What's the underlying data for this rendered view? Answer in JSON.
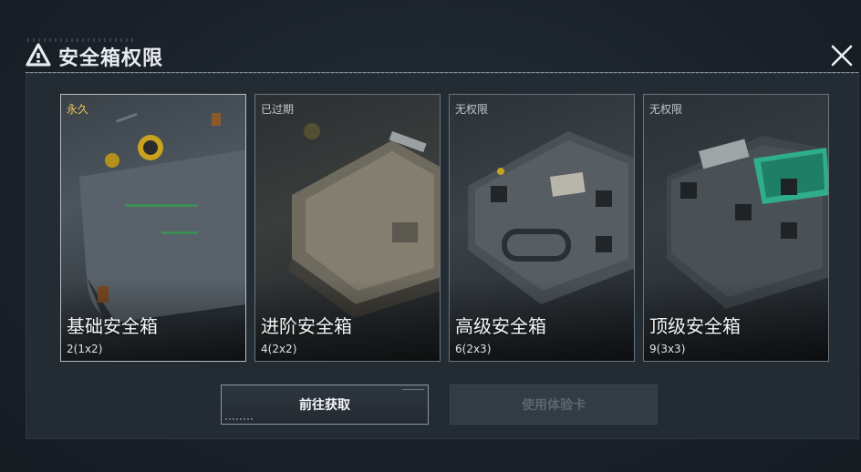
{
  "header": {
    "title": "安全箱权限",
    "icon": "warning-triangle-icon",
    "close_icon": "close-icon"
  },
  "cards": [
    {
      "status": "永久",
      "name": "基础安全箱",
      "size": "2(1x2)",
      "selected": true
    },
    {
      "status": "已过期",
      "name": "进阶安全箱",
      "size": "4(2x2)",
      "selected": false
    },
    {
      "status": "无权限",
      "name": "高级安全箱",
      "size": "6(2x3)",
      "selected": false
    },
    {
      "status": "无权限",
      "name": "顶级安全箱",
      "size": "9(3x3)",
      "selected": false
    }
  ],
  "buttons": {
    "go_obtain": "前往获取",
    "use_trial_card": "使用体验卡",
    "use_trial_card_disabled": true
  },
  "colors": {
    "permanent_status": "#e8c65a",
    "accent_green": "#2fae8c",
    "background": "#1b222b"
  }
}
